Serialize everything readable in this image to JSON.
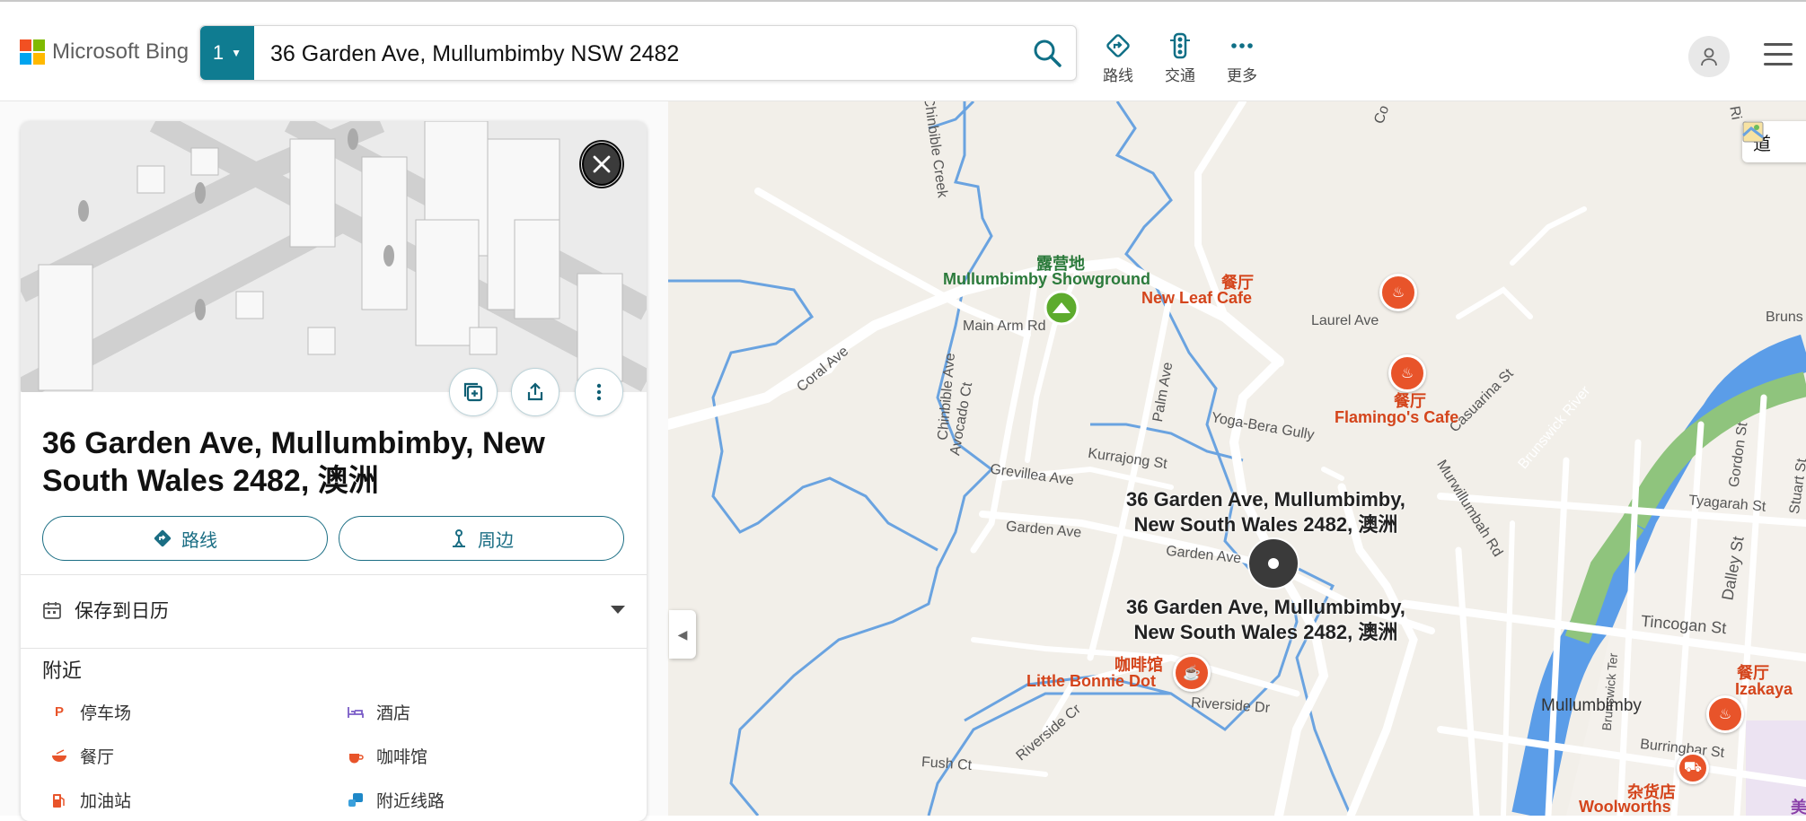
{
  "brand": {
    "name": "Microsoft Bing",
    "logo_colors": [
      "#f25022",
      "#7fba00",
      "#00a4ef",
      "#ffb900"
    ]
  },
  "search": {
    "tab_label": "1",
    "query": "36 Garden Ave, Mullumbimby NSW 2482"
  },
  "header_actions": [
    {
      "label": "路线",
      "icon": "directions-icon"
    },
    {
      "label": "交通",
      "icon": "traffic-light-icon"
    },
    {
      "label": "更多",
      "icon": "more-icon"
    }
  ],
  "panel": {
    "title": "36 Garden Ave, Mullumbimby, New South Wales 2482, 澳洲",
    "buttons": {
      "directions": "路线",
      "nearby": "周边"
    },
    "save_calendar": "保存到日历",
    "nearby_title": "附近",
    "nearby_items": [
      "停车场",
      "酒店",
      "餐厅",
      "咖啡馆",
      "加油站",
      "附近线路"
    ]
  },
  "map": {
    "map_type_label": "道",
    "accent": "#e8542a",
    "address_label_1": "36 Garden Ave, Mullumbimby,",
    "address_label_2": "New South Wales 2482, 澳洲",
    "pois": {
      "showground_cat": "露营地",
      "showground_name": "Mullumbimby Showground",
      "newleaf_cat": "餐厅",
      "newleaf_name": "New Leaf Cafe",
      "flamingo_cat": "餐厅",
      "flamingo_name": "Flamingo's Cafe",
      "bonnie_cat": "咖啡馆",
      "bonnie_name": "Little Bonnie Dot",
      "izakaya_cat": "餐厅",
      "izakaya_name": "Izakaya",
      "woolworths_cat": "杂货店",
      "woolworths_name": "Woolworths",
      "purple_partial": "美"
    },
    "streets": {
      "main_arm": "Main Arm Rd",
      "laurel": "Laurel Ave",
      "coral": "Coral Ave",
      "chinbible_ave": "Chinbible Ave",
      "chinbible_creek": "Chinbible Creek",
      "avocado": "Avocado Ct",
      "palm": "Palm Ave",
      "yoga": "Yoga-Bera Gully",
      "kurrajong": "Kurrajong St",
      "grevillea": "Grevillea Ave",
      "garden1": "Garden Ave",
      "garden2": "Garden Ave",
      "casuarina": "Casuarina St",
      "brunswick_river": "Brunswick River",
      "murwillumbah": "Murwillumbah Rd",
      "tyagarah": "Tyagarah St",
      "gordon": "Gordon St",
      "stuart": "Stuart St",
      "dalley": "Dalley St",
      "tincogan": "Tincogan St",
      "brunswick_ter": "Brunswick Ter",
      "mullumbimby": "Mullumbimby",
      "burringbar": "Burringbar St",
      "riverside_dr": "Riverside Dr",
      "riverside_cr": "Riverside Cr",
      "fush": "Fush Ct",
      "brunswick_top": "Bruns",
      "co_top": "Co",
      "ri_top": "Ri"
    }
  }
}
